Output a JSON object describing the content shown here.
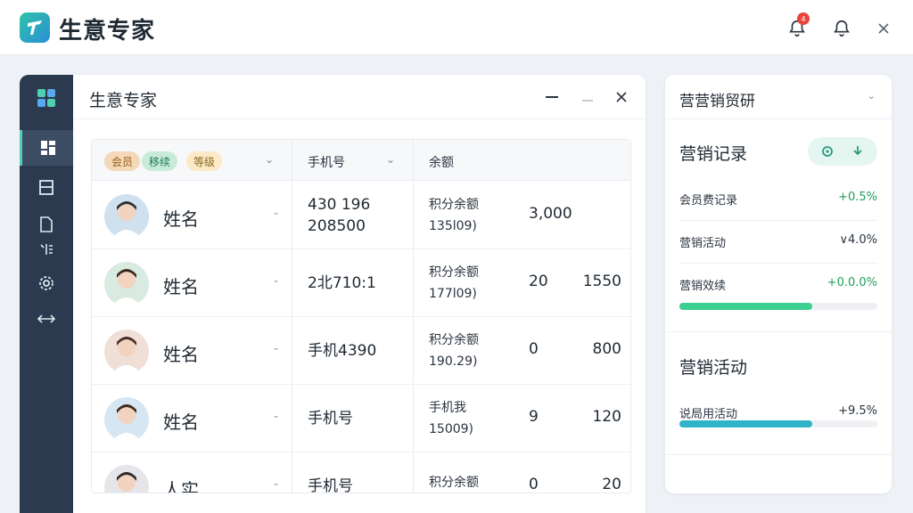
{
  "app": {
    "title": "生意专家",
    "notification_count": "4"
  },
  "main": {
    "title": "生意专家",
    "filters": [
      {
        "label": "会员",
        "bg": "#f3d9b8",
        "fg": "#9a5a1a"
      },
      {
        "label": "移续",
        "bg": "#c9ecd9",
        "fg": "#1f7a52"
      },
      {
        "label": "等级",
        "bg": "#fbe9c7",
        "fg": "#8a6a20"
      }
    ],
    "columns": [
      "手机号",
      "余额"
    ],
    "rows": [
      {
        "name": "姓名",
        "dash": "-",
        "phone1": "430 196",
        "phone2": "208500",
        "pts1": "积分余额",
        "pts2": "135l09)",
        "a": "3,000",
        "b": ""
      },
      {
        "name": "姓名",
        "dash": "-",
        "phone1": "2北710:1",
        "phone2": "",
        "pts1": "积分余额",
        "pts2": "177l09)",
        "a": "20",
        "b": "1550"
      },
      {
        "name": "姓名",
        "dash": "-",
        "phone1": "手机4390",
        "phone2": "",
        "pts1": "积分余额",
        "pts2": "190.29)",
        "a": "0",
        "b": "800"
      },
      {
        "name": "姓名",
        "dash": "-",
        "phone1": "手机号",
        "phone2": "",
        "pts1": "手机我",
        "pts2": "15009)",
        "a": "9",
        "b": "120"
      },
      {
        "name": "人实",
        "dash": "-",
        "phone1": "手机号",
        "phone2": "",
        "pts1": "积分余额",
        "pts2": "",
        "a": "0",
        "b": "20"
      }
    ]
  },
  "right": {
    "title": "营营销贸研",
    "section1": {
      "title": "营销记录",
      "stats": [
        {
          "label": "会员费记录",
          "value": "+0.5%",
          "color": "#1f9e5a"
        },
        {
          "label": "营销活动",
          "value": "∨4.0%",
          "color": "#2b3440"
        },
        {
          "label": "营销效续",
          "value": "+0.0.0%",
          "color": "#1f9e5a"
        }
      ],
      "progress": 0.67
    },
    "section2": {
      "title": "营销活动",
      "stat": {
        "label": "说局用活动",
        "value": "+9.5%",
        "color": "#2b3440"
      },
      "progress": 0.67
    }
  },
  "colors": {
    "accent": "#2fc3a8",
    "sidebar": "#2b3a4e",
    "progress1": "#3ccf91",
    "progress2": "#2fb3c8"
  }
}
